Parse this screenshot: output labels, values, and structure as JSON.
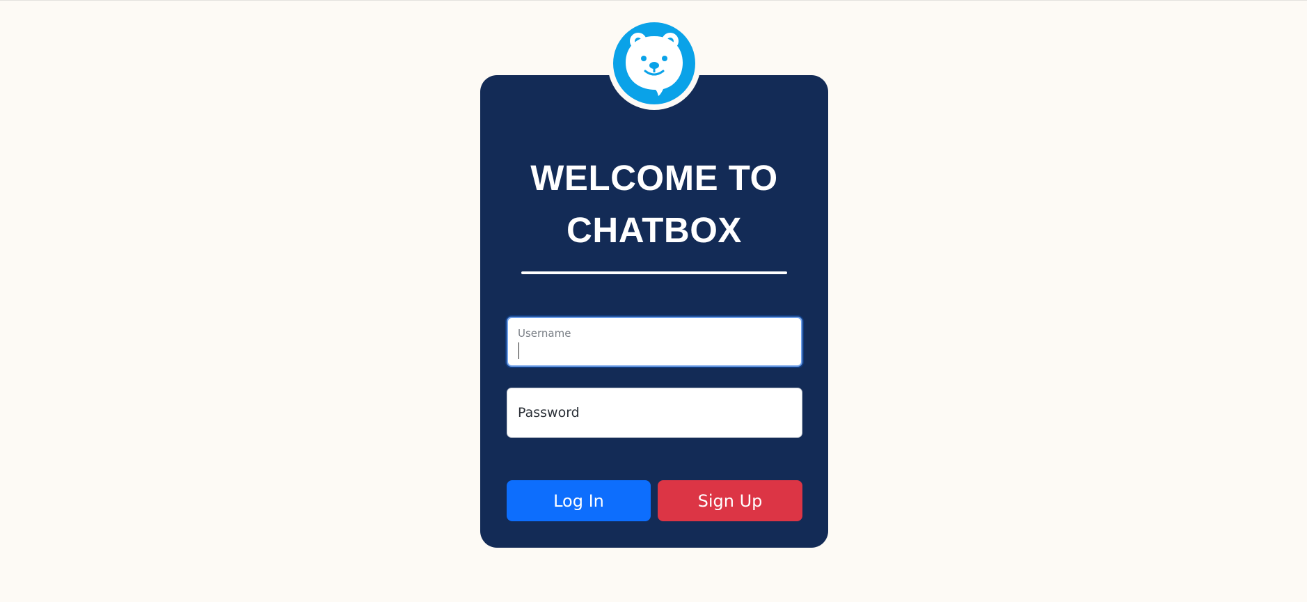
{
  "app": {
    "title_line1": "WELCOME TO",
    "title_line2": "CHATBOX"
  },
  "logo": {
    "icon": "bear-chat-icon",
    "color": "#0aa2e8"
  },
  "form": {
    "username_label": "Username",
    "username_value": "",
    "password_placeholder": "Password",
    "login_label": "Log In",
    "signup_label": "Sign Up"
  },
  "colors": {
    "background": "#fdfaf5",
    "card": "#132b56",
    "login_button": "#0d6efd",
    "signup_button": "#dc3545"
  }
}
